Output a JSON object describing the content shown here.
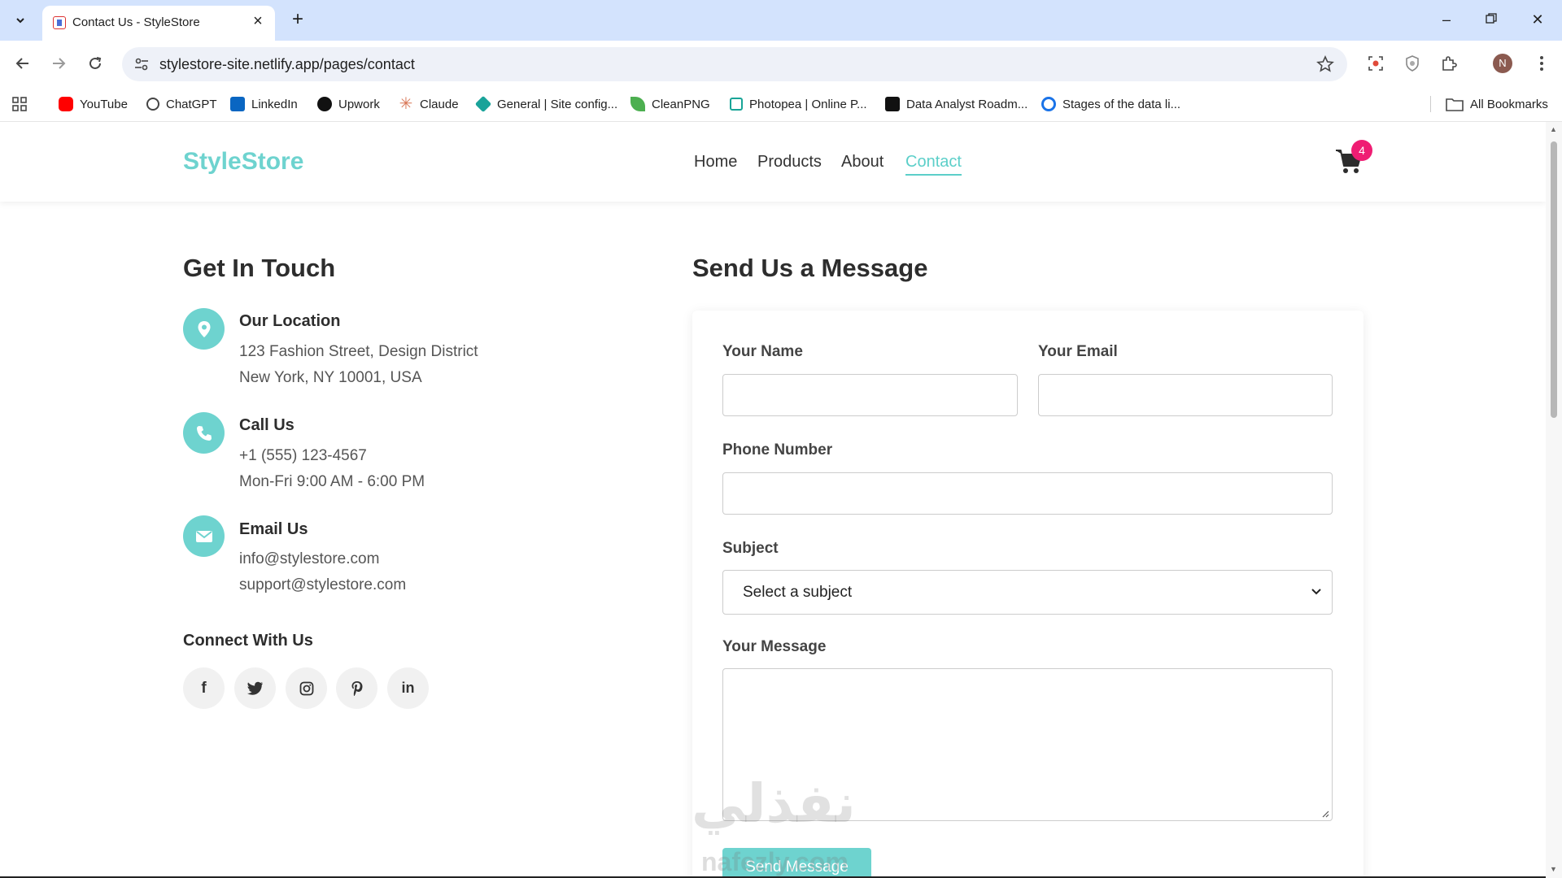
{
  "browser": {
    "tab_title": "Contact Us - StyleStore",
    "url": "stylestore-site.netlify.app/pages/contact",
    "profile_initial": "N",
    "bookmarks": [
      {
        "label": "YouTube",
        "color": "#ff0000"
      },
      {
        "label": "ChatGPT",
        "color": "#444444"
      },
      {
        "label": "LinkedIn",
        "color": "#0a66c2"
      },
      {
        "label": "Upwork",
        "color": "#111111"
      },
      {
        "label": "Claude",
        "color": "#d97757"
      },
      {
        "label": "General | Site config...",
        "color": "#1aa39a"
      },
      {
        "label": "CleanPNG",
        "color": "#4caf50"
      },
      {
        "label": "Photopea | Online P...",
        "color": "#18a497"
      },
      {
        "label": "Data Analyst Roadm...",
        "color": "#111111"
      },
      {
        "label": "Stages of the data li...",
        "color": "#1a73e8"
      }
    ],
    "all_bookmarks_label": "All Bookmarks"
  },
  "site": {
    "logo": "StyleStore",
    "nav": [
      "Home",
      "Products",
      "About",
      "Contact"
    ],
    "active_nav": "Contact",
    "cart_count": "4",
    "accent_color": "#6ed3cf",
    "badge_color": "#ef1d73"
  },
  "contact_info": {
    "heading": "Get In Touch",
    "location": {
      "title": "Our Location",
      "lines": [
        "123 Fashion Street, Design District",
        "New York, NY 10001, USA"
      ],
      "icon": "map-pin-icon"
    },
    "call": {
      "title": "Call Us",
      "lines": [
        "+1 (555) 123-4567",
        "Mon-Fri 9:00 AM - 6:00 PM"
      ],
      "icon": "phone-icon"
    },
    "email": {
      "title": "Email Us",
      "lines": [
        "info@stylestore.com",
        "support@stylestore.com"
      ],
      "icon": "envelope-icon"
    },
    "connect_heading": "Connect With Us",
    "socials": [
      "f",
      "twitter",
      "instagram",
      "pinterest",
      "in"
    ]
  },
  "form": {
    "heading": "Send Us a Message",
    "name_label": "Your Name",
    "name_value": "",
    "email_label": "Your Email",
    "email_value": "",
    "phone_label": "Phone Number",
    "phone_value": "",
    "subject_label": "Subject",
    "subject_value": "Select a subject",
    "message_label": "Your Message",
    "message_value": "",
    "submit_label": "Send Message"
  },
  "watermark": {
    "arabic": "نفذلي",
    "latin": "nafezly.com"
  }
}
